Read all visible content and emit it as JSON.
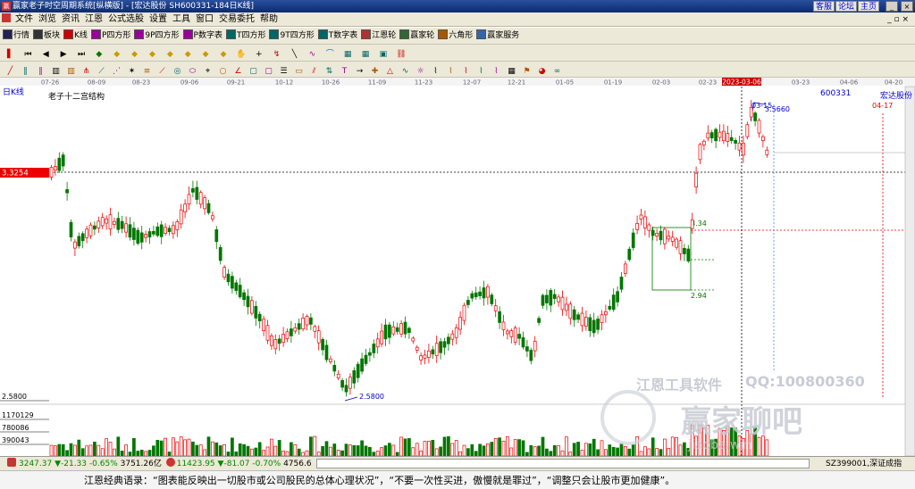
{
  "titlebar": {
    "app_title": "赢家老子时空周期系统[纵横版] - [宏达股份  SH600331-184日K线]",
    "buttons": [
      "客服",
      "论坛",
      "主页"
    ]
  },
  "menu": [
    "文件",
    "浏览",
    "资讯",
    "江恩",
    "公式选股",
    "设置",
    "工具",
    "窗口",
    "交易委托",
    "帮助"
  ],
  "toolbar1": {
    "items": [
      {
        "label": "行情",
        "icon": "grid-icon",
        "color": "#225"
      },
      {
        "label": "板块",
        "icon": "blocks-icon",
        "color": "#333"
      },
      {
        "label": "K线",
        "icon": "candlestick-icon",
        "color": "#c00"
      },
      {
        "label": "P四方形",
        "icon": "p-square-icon",
        "color": "#909"
      },
      {
        "label": "9P四方形",
        "icon": "9p-square-icon",
        "color": "#909"
      },
      {
        "label": "P数字表",
        "icon": "p-table-icon",
        "color": "#909"
      },
      {
        "label": "T四方形",
        "icon": "t-square-icon",
        "color": "#066"
      },
      {
        "label": "9T四方形",
        "icon": "9t-square-icon",
        "color": "#066"
      },
      {
        "label": "T数字表",
        "icon": "t-table-icon",
        "color": "#066"
      },
      {
        "label": "江恩轮",
        "icon": "gann-wheel-icon",
        "color": "#a33"
      },
      {
        "label": "赢家轮",
        "icon": "winner-wheel-icon",
        "color": "#363"
      },
      {
        "label": "六角形",
        "icon": "hexagon-icon",
        "color": "#a50"
      },
      {
        "label": "赢家服务",
        "icon": "service-icon",
        "color": "#36a"
      }
    ]
  },
  "chart": {
    "period": "日K线",
    "study_title": "老子十二宫结构",
    "stock_code": "600331",
    "stock_name": "宏达股份",
    "cursor_date": "2023-03-06",
    "dates": [
      "07-26",
      "08-09",
      "08-23",
      "09-06",
      "09-21",
      "10-12",
      "10-26",
      "11-09",
      "11-23",
      "12-07",
      "12-21",
      "01-05",
      "01-19",
      "02-03",
      "02-23",
      "2023-03-06",
      "03-23",
      "04-06",
      "04-20"
    ],
    "price_marker": "3.3254",
    "low_label": "2.5800",
    "low_axis": "2.5800",
    "box_top": "3.34",
    "box_bottom": "2.94",
    "peak_label": "03-15",
    "peak_value": "3.5660",
    "future_date": "04-17",
    "volume_ticks": [
      "1170129",
      "780086",
      "390043"
    ],
    "watermark_company": "江恩工具软件",
    "watermark_qq": "QQ:100800360",
    "watermark_logo": "赢家聊吧",
    "watermark_url": "jiaoba.win"
  },
  "status": {
    "sh_index": "3247.37",
    "sh_change": "▼-21.33",
    "sh_pct": "-0.65%",
    "sh_amount": "3751.26亿",
    "sz_index": "11423.95",
    "sz_change": "▼-81.07",
    "sz_pct": "-0.70%",
    "sz_amount": "4756.6",
    "right_text": "SZ399001,深证成指"
  },
  "quote": "江恩经典语录：“图表能反映出一切股市或公司股民的总体心理状况”，“不要一次性买进，傲慢就是罪过”，“调整只会让股市更加健康”。"
}
